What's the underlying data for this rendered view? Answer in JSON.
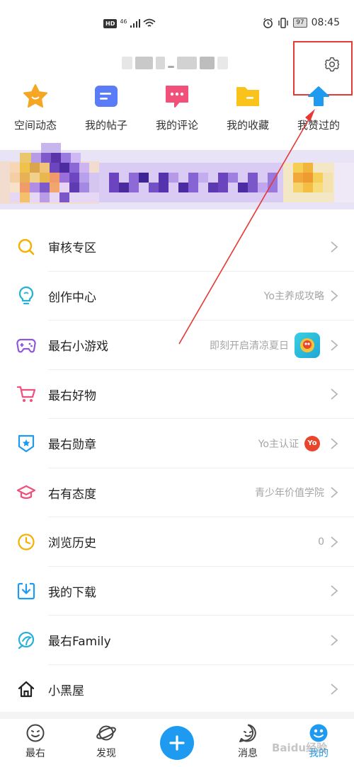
{
  "status_bar": {
    "hd": "HD",
    "network": "46",
    "battery": "97",
    "time": "08:45"
  },
  "quick_actions": [
    {
      "label": "空间动态",
      "icon": "star-icon",
      "color": "#f5a623"
    },
    {
      "label": "我的帖子",
      "icon": "post-icon",
      "color": "#5b7cf7"
    },
    {
      "label": "我的评论",
      "icon": "comment-icon",
      "color": "#f0507a"
    },
    {
      "label": "我的收藏",
      "icon": "folder-icon",
      "color": "#f9c31b"
    },
    {
      "label": "我赞过的",
      "icon": "like-icon",
      "color": "#1e9bf0"
    }
  ],
  "menu": [
    {
      "label": "审核专区",
      "icon": "search-icon",
      "hint": "",
      "color": "#f5b000"
    },
    {
      "label": "创作中心",
      "icon": "lightbulb-icon",
      "hint": "Yo主养成攻略",
      "color": "#25b0d8"
    },
    {
      "label": "最右小游戏",
      "icon": "gamepad-icon",
      "hint": "即刻开启清凉夏日",
      "color": "#8f56d8"
    },
    {
      "label": "最右好物",
      "icon": "cart-icon",
      "hint": "",
      "color": "#f0507a"
    },
    {
      "label": "最右勋章",
      "icon": "medal-icon",
      "hint": "Yo主认证",
      "color": "#1e9bf0"
    },
    {
      "label": "右有态度",
      "icon": "graduation-cap-icon",
      "hint": "青少年价值学院",
      "color": "#f0507a"
    },
    {
      "label": "浏览历史",
      "icon": "clock-icon",
      "hint": "0",
      "color": "#f5b000"
    },
    {
      "label": "我的下载",
      "icon": "download-icon",
      "hint": "",
      "color": "#1e9bf0"
    },
    {
      "label": "最右Family",
      "icon": "family-icon",
      "hint": "",
      "color": "#25b0d8"
    },
    {
      "label": "小黑屋",
      "icon": "house-icon",
      "hint": "",
      "color": "#222222"
    }
  ],
  "yo_badge": "Yo",
  "bottom_nav": [
    {
      "label": "最右",
      "icon": "smile-icon"
    },
    {
      "label": "发现",
      "icon": "planet-icon"
    },
    {
      "label": "",
      "icon": "add-icon"
    },
    {
      "label": "消息",
      "icon": "message-icon"
    },
    {
      "label": "我的",
      "icon": "profile-icon"
    }
  ],
  "accent_color": "#1e9bf0",
  "watermark": "Baidu经验"
}
